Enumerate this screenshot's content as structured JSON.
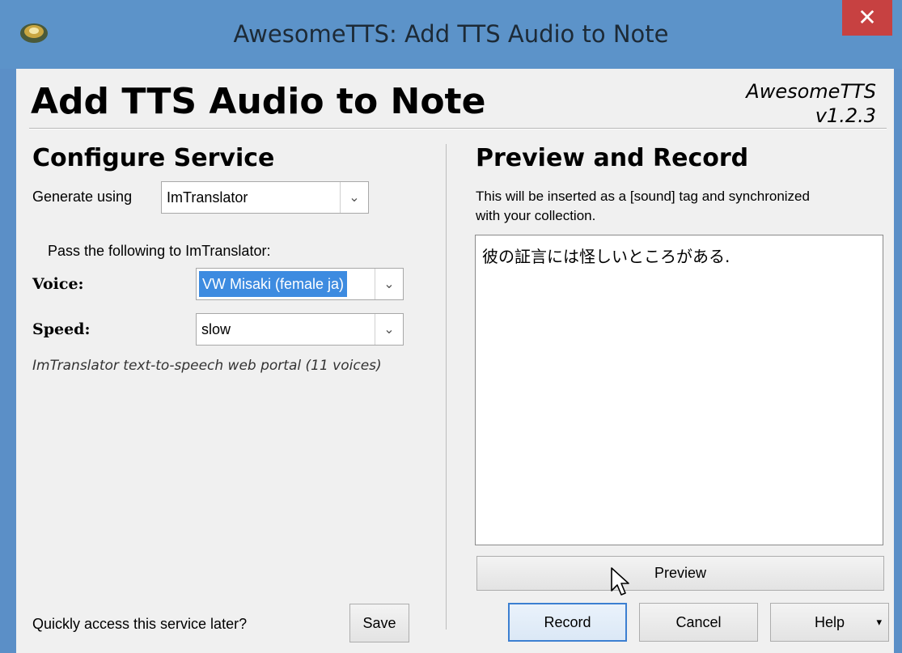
{
  "window": {
    "title": "AwesomeTTS: Add TTS Audio to Note",
    "close_glyph": "✕",
    "app_icon": "speaker-icon"
  },
  "header": {
    "title": "Add TTS Audio to Note",
    "version_name": "AwesomeTTS",
    "version_number": "v1.2.3"
  },
  "configure": {
    "heading": "Configure Service",
    "generate_label": "Generate using",
    "service_value": "ImTranslator",
    "pass_label": "Pass the following to ImTranslator:",
    "voice_label": "Voice:",
    "voice_value": "VW Misaki (female ja)",
    "speed_label": "Speed:",
    "speed_value": "slow",
    "description": "ImTranslator text-to-speech web portal (11 voices)",
    "quick_access_label": "Quickly access this service later?",
    "save_label": "Save"
  },
  "preview": {
    "heading": "Preview and Record",
    "info": "This will be inserted as a [sound] tag and synchronized with your collection.",
    "text": "彼の証言には怪しいところがある.",
    "preview_label": "Preview"
  },
  "footer": {
    "record_label": "Record",
    "cancel_label": "Cancel",
    "help_label": "Help",
    "help_arrow": "▾"
  },
  "colors": {
    "titlebar": "#5c93c9",
    "close": "#c74141",
    "selection": "#3d8be0",
    "default_button_border": "#3c7fd1"
  }
}
